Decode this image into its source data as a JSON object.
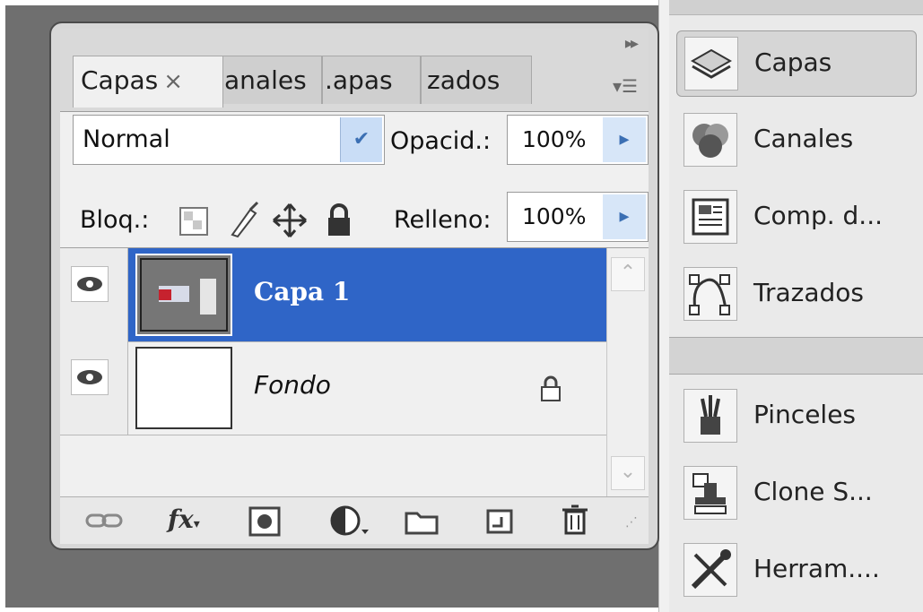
{
  "layers_panel": {
    "tabs": [
      {
        "label": "Capas",
        "close": "×"
      },
      {
        "label": "anales"
      },
      {
        "label": ".apas"
      },
      {
        "label": "zados"
      }
    ],
    "blend_mode": "Normal",
    "opacity_label": "Opacid.:",
    "opacity_value": "100%",
    "lock_label": "Bloq.:",
    "fill_label": "Relleno:",
    "fill_value": "100%",
    "layers": [
      {
        "name": "Capa 1",
        "selected": true
      },
      {
        "name": "Fondo",
        "locked": true
      }
    ]
  },
  "dock": {
    "group1": [
      {
        "label": "Capas",
        "icon": "layers-icon",
        "active": true
      },
      {
        "label": "Canales",
        "icon": "channels-icon"
      },
      {
        "label": "Comp. d...",
        "icon": "layer-comps-icon"
      },
      {
        "label": "Trazados",
        "icon": "paths-icon"
      }
    ],
    "group2": [
      {
        "label": "Pinceles",
        "icon": "brushes-icon"
      },
      {
        "label": "Clone S...",
        "icon": "clone-source-icon"
      },
      {
        "label": "Herram....",
        "icon": "tool-presets-icon"
      }
    ]
  },
  "colors": {
    "selection": "#2f65c7",
    "workspace": "#6f6f6f"
  }
}
